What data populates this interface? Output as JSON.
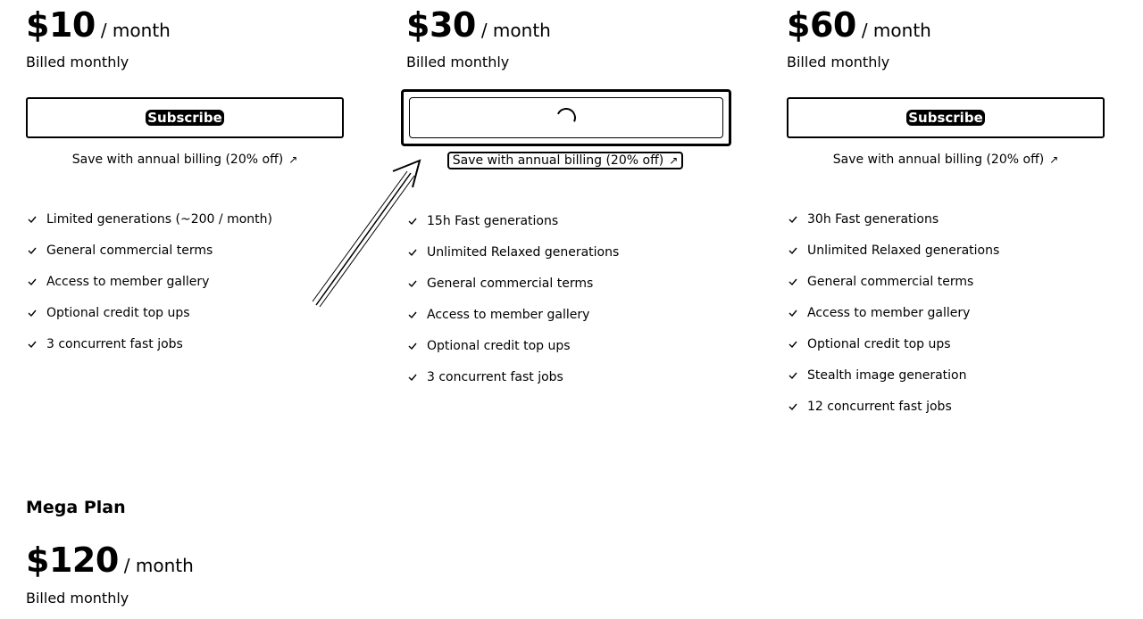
{
  "plans": [
    {
      "price": "$10",
      "period": "/ month",
      "billing": "Billed monthly",
      "subscribe_label": "Subscribe",
      "annual_label": "Save with annual billing (20% off)",
      "annual_arrow": "↗",
      "features": [
        "Limited generations (~200 / month)",
        "General commercial terms",
        "Access to member gallery",
        "Optional credit top ups",
        "3 concurrent fast jobs"
      ]
    },
    {
      "price": "$30",
      "period": "/ month",
      "billing": "Billed monthly",
      "subscribe_state": "loading",
      "annual_label": "Save with annual billing (20% off)",
      "annual_arrow": "↗",
      "features": [
        "15h Fast generations",
        "Unlimited Relaxed generations",
        "General commercial terms",
        "Access to member gallery",
        "Optional credit top ups",
        "3 concurrent fast jobs"
      ]
    },
    {
      "price": "$60",
      "period": "/ month",
      "billing": "Billed monthly",
      "subscribe_label": "Subscribe",
      "annual_label": "Save with annual billing (20% off)",
      "annual_arrow": "↗",
      "features": [
        "30h Fast generations",
        "Unlimited Relaxed generations",
        "General commercial terms",
        "Access to member gallery",
        "Optional credit top ups",
        "Stealth image generation",
        "12 concurrent fast jobs"
      ]
    },
    {
      "title": "Mega Plan",
      "price": "$120",
      "period": "/ month",
      "billing": "Billed monthly"
    }
  ],
  "icons": {
    "check": "check-icon",
    "external": "external-link-arrow-icon",
    "spinner": "loading-spinner-icon"
  },
  "colors": {
    "foreground": "#000000",
    "background": "#ffffff"
  }
}
